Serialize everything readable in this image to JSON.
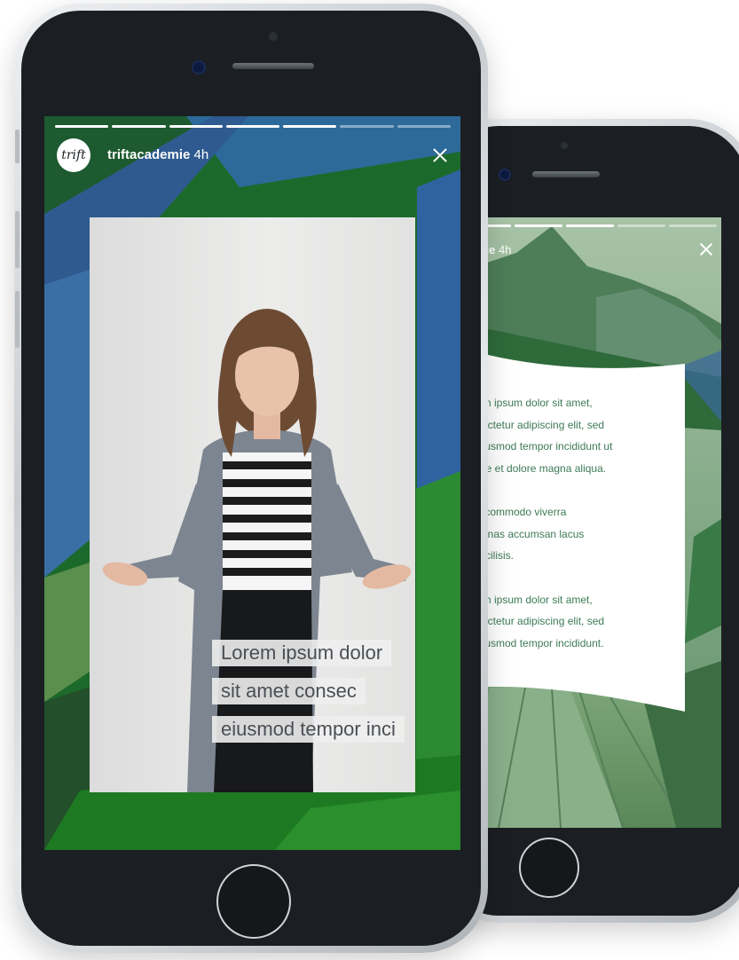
{
  "front_story": {
    "username": "triftacademie",
    "time": "4h",
    "avatar_text": "trift",
    "progress": {
      "total": 7,
      "completed": 5
    },
    "caption": [
      "Lorem ipsum dolor",
      "sit amet consec",
      "eiusmod tempor inci"
    ]
  },
  "back_story": {
    "username": "mie",
    "time": "4h",
    "progress": {
      "total": 5,
      "completed": 3
    },
    "paragraphs": [
      [
        "em ipsum dolor sit amet,",
        "sectetur adipiscing elit, sed",
        "eiusmod tempor incididunt ut",
        "ore et dolore magna aliqua."
      ],
      [
        "s commodo viverra",
        "cenas accumsan lacus",
        "facilisis."
      ],
      [
        "em ipsum dolor sit amet,",
        "sectetur adipiscing elit, sed",
        "eiusmod tempor incididunt."
      ]
    ]
  },
  "colors": {
    "green": "#1f6a2c",
    "blue": "#2f5a9c",
    "text_green": "#3d7a57"
  }
}
